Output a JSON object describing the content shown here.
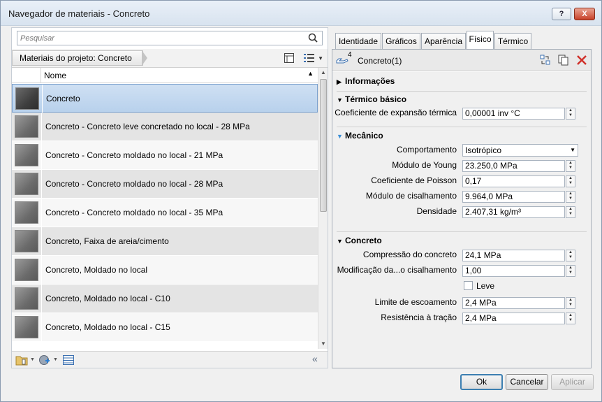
{
  "window": {
    "title": "Navegador de materiais - Concreto",
    "help_label": "?",
    "close_label": "X"
  },
  "search": {
    "placeholder": "Pesquisar"
  },
  "breadcrumb": {
    "label": "Materiais do projeto: Concreto"
  },
  "list": {
    "column_header": "Nome",
    "items": [
      {
        "label": "Concreto",
        "selected": true
      },
      {
        "label": "Concreto - Concreto leve concretado no local - 28 MPa"
      },
      {
        "label": "Concreto - Concreto moldado no local - 21 MPa"
      },
      {
        "label": "Concreto - Concreto moldado no local - 28 MPa"
      },
      {
        "label": "Concreto - Concreto moldado no local - 35 MPa"
      },
      {
        "label": "Concreto, Faixa de areia/cimento"
      },
      {
        "label": "Concreto, Moldado no local"
      },
      {
        "label": "Concreto, Moldado no local - C10"
      },
      {
        "label": "Concreto, Moldado no local - C15"
      }
    ]
  },
  "tabs": [
    {
      "label": "Identidade"
    },
    {
      "label": "Gráficos"
    },
    {
      "label": "Aparência"
    },
    {
      "label": "Físico",
      "active": true
    },
    {
      "label": "Térmico"
    }
  ],
  "asset": {
    "name": "Concreto(1)",
    "count": "4"
  },
  "sections": {
    "informacoes": "Informações",
    "termico": "Térmico básico",
    "mecanico": "Mecânico",
    "concreto": "Concreto"
  },
  "props": {
    "expansao": {
      "label": "Coeficiente de expansão térmica",
      "value": "0,00001 inv °C"
    },
    "comportamento": {
      "label": "Comportamento",
      "value": "Isotrópico"
    },
    "young": {
      "label": "Módulo de Young",
      "value": "23.250,0 MPa"
    },
    "poisson": {
      "label": "Coeficiente de Poisson",
      "value": "0,17"
    },
    "cisalhamento": {
      "label": "Módulo de cisalhamento",
      "value": "9.964,0 MPa"
    },
    "densidade": {
      "label": "Densidade",
      "value": "2.407,31 kg/m³"
    },
    "compressao": {
      "label": "Compressão do concreto",
      "value": "24,1 MPa"
    },
    "modificacao": {
      "label": "Modificação da...o cisalhamento",
      "value": "1,00"
    },
    "leve": {
      "label": "Leve",
      "checked": false
    },
    "escoamento": {
      "label": "Limite de escoamento",
      "value": "2,4 MPa"
    },
    "tracao": {
      "label": "Resistência à tração",
      "value": "2,4 MPa"
    }
  },
  "buttons": {
    "ok": "Ok",
    "cancel": "Cancelar",
    "apply": "Aplicar"
  }
}
